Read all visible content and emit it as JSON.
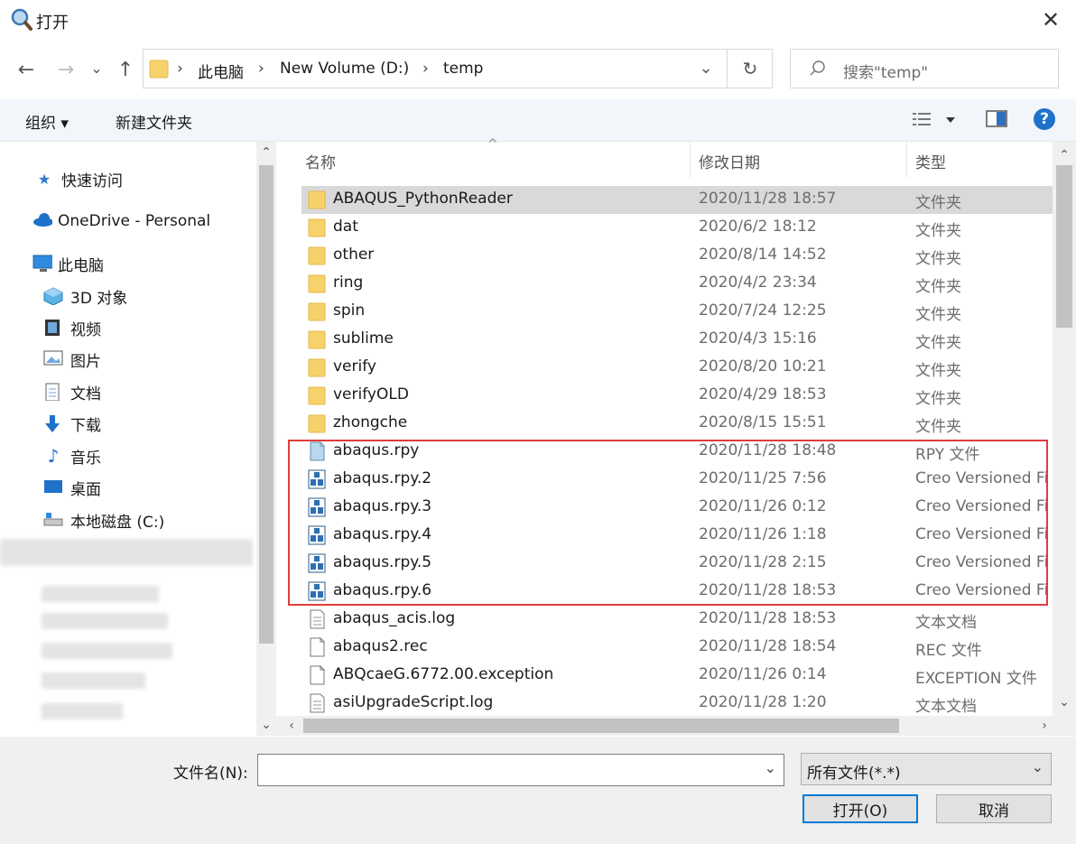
{
  "window": {
    "title": "打开",
    "close_glyph": "✕"
  },
  "nav": {
    "back": "←",
    "forward": "→",
    "recent": "⌄",
    "up": "↑"
  },
  "address": {
    "crumbs": [
      "此电脑",
      "New Volume (D:)",
      "temp"
    ],
    "sep": "›",
    "dropdown": "⌄",
    "refresh": "↻"
  },
  "search": {
    "placeholder": "搜索\"temp\""
  },
  "toolbar": {
    "organize": "组织 ▾",
    "new_folder": "新建文件夹",
    "help": "?"
  },
  "sidebar": {
    "items": [
      {
        "label": "快速访问",
        "icon": "star-icon"
      },
      {
        "label": "OneDrive - Personal",
        "icon": "cloud-icon"
      },
      {
        "label": "此电脑",
        "icon": "computer-icon"
      },
      {
        "label": "3D 对象",
        "icon": "cube-icon"
      },
      {
        "label": "视频",
        "icon": "video-icon"
      },
      {
        "label": "图片",
        "icon": "picture-icon"
      },
      {
        "label": "文档",
        "icon": "document-icon"
      },
      {
        "label": "下载",
        "icon": "download-icon"
      },
      {
        "label": "音乐",
        "icon": "music-icon"
      },
      {
        "label": "桌面",
        "icon": "desktop-icon"
      },
      {
        "label": "本地磁盘 (C:)",
        "icon": "drive-icon"
      }
    ]
  },
  "columns": {
    "name": "名称",
    "date": "修改日期",
    "type": "类型"
  },
  "files": [
    {
      "name": "ABAQUS_PythonReader",
      "date": "2020/11/28 18:57",
      "type": "文件夹",
      "icon": "folder-icon",
      "selected": true
    },
    {
      "name": "dat",
      "date": "2020/6/2 18:12",
      "type": "文件夹",
      "icon": "folder-icon"
    },
    {
      "name": "other",
      "date": "2020/8/14 14:52",
      "type": "文件夹",
      "icon": "folder-icon"
    },
    {
      "name": "ring",
      "date": "2020/4/2 23:34",
      "type": "文件夹",
      "icon": "folder-icon"
    },
    {
      "name": "spin",
      "date": "2020/7/24 12:25",
      "type": "文件夹",
      "icon": "folder-icon"
    },
    {
      "name": "sublime",
      "date": "2020/4/3 15:16",
      "type": "文件夹",
      "icon": "folder-icon"
    },
    {
      "name": "verify",
      "date": "2020/8/20 10:21",
      "type": "文件夹",
      "icon": "folder-icon"
    },
    {
      "name": "verifyOLD",
      "date": "2020/4/29 18:53",
      "type": "文件夹",
      "icon": "folder-icon"
    },
    {
      "name": "zhongche",
      "date": "2020/8/15 15:51",
      "type": "文件夹",
      "icon": "folder-icon"
    },
    {
      "name": "abaqus.rpy",
      "date": "2020/11/28 18:48",
      "type": "RPY 文件",
      "icon": "rpy-file-icon"
    },
    {
      "name": "abaqus.rpy.2",
      "date": "2020/11/25 7:56",
      "type": "Creo Versioned Fi",
      "icon": "creo-file-icon"
    },
    {
      "name": "abaqus.rpy.3",
      "date": "2020/11/26 0:12",
      "type": "Creo Versioned Fi",
      "icon": "creo-file-icon"
    },
    {
      "name": "abaqus.rpy.4",
      "date": "2020/11/26 1:18",
      "type": "Creo Versioned Fi",
      "icon": "creo-file-icon"
    },
    {
      "name": "abaqus.rpy.5",
      "date": "2020/11/28 2:15",
      "type": "Creo Versioned Fi",
      "icon": "creo-file-icon"
    },
    {
      "name": "abaqus.rpy.6",
      "date": "2020/11/28 18:53",
      "type": "Creo Versioned Fi",
      "icon": "creo-file-icon"
    },
    {
      "name": "abaqus_acis.log",
      "date": "2020/11/28 18:53",
      "type": "文本文档",
      "icon": "text-file-icon"
    },
    {
      "name": "abaqus2.rec",
      "date": "2020/11/28 18:54",
      "type": "REC 文件",
      "icon": "blank-file-icon"
    },
    {
      "name": "ABQcaeG.6772.00.exception",
      "date": "2020/11/26 0:14",
      "type": "EXCEPTION 文件",
      "icon": "blank-file-icon"
    },
    {
      "name": "asiUpgradeScript.log",
      "date": "2020/11/28 1:20",
      "type": "文本文档",
      "icon": "text-file-icon"
    }
  ],
  "highlight_color": "#e03c3c",
  "footer": {
    "filename_label": "文件名(N):",
    "filename_value": "",
    "filter_value": "所有文件(*.*)",
    "open_button": "打开(O)",
    "cancel_button": "取消"
  }
}
